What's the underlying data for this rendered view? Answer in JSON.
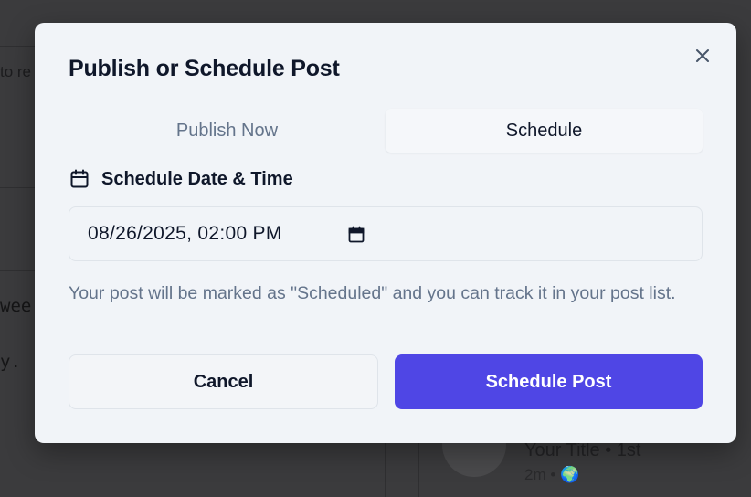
{
  "background": {
    "snippet_top": "to re",
    "snippet_mid": "wee",
    "snippet_bottom": "y.",
    "card_title": "Your Title • 1st",
    "card_meta": "2m • 🌍"
  },
  "modal": {
    "title": "Publish or Schedule Post",
    "close_icon": "close-icon",
    "tabs": [
      {
        "label": "Publish Now",
        "active": false
      },
      {
        "label": "Schedule",
        "active": true
      }
    ],
    "schedule_label": "Schedule Date & Time",
    "datetime_value": "08/26/2025, 02:00 PM",
    "hint": "Your post will be marked as \"Scheduled\" and you can track it in your post list.",
    "cancel_label": "Cancel",
    "submit_label": "Schedule Post"
  },
  "colors": {
    "primary": "#4f46e5",
    "modal_bg": "#f1f4f8",
    "text_dark": "#0f172a",
    "text_muted": "#64748b"
  }
}
